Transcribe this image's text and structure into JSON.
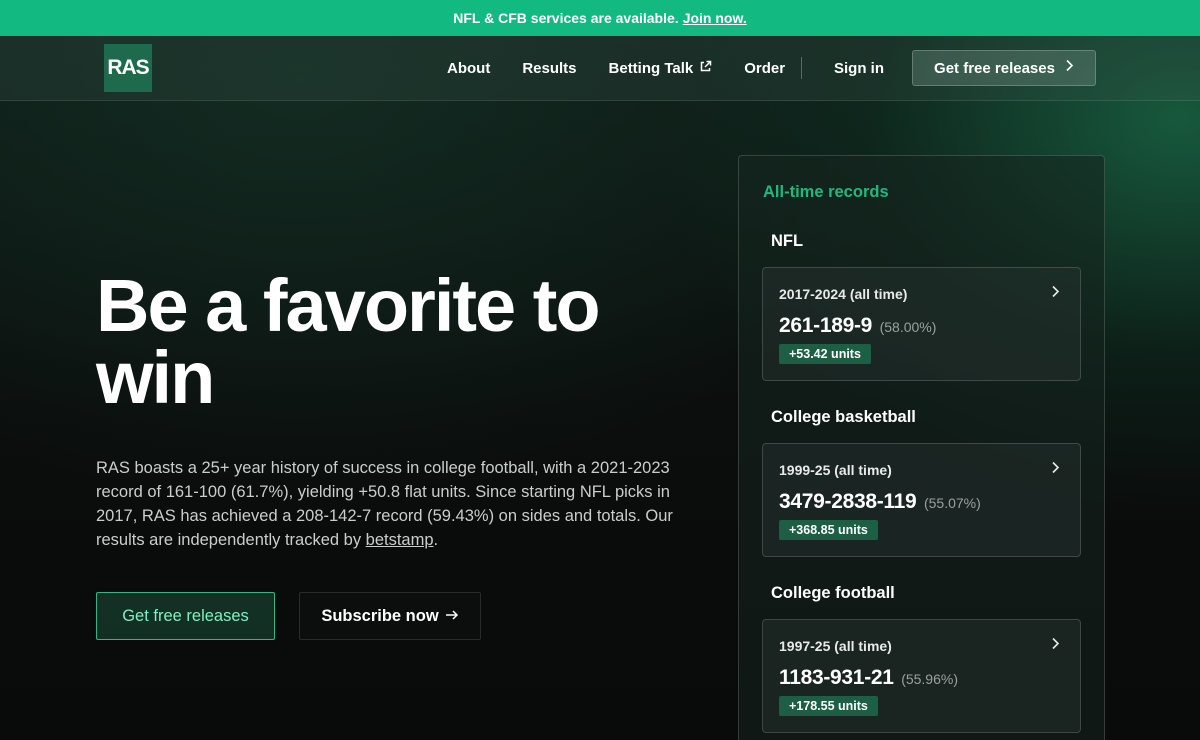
{
  "announcement": {
    "text": "NFL & CFB services are available.",
    "link": "Join now."
  },
  "nav": {
    "logo": "RAS",
    "links": [
      "About",
      "Results",
      "Betting Talk",
      "Order"
    ],
    "signin": "Sign in",
    "cta": "Get free releases"
  },
  "hero": {
    "title": "Be a favorite to win",
    "description": "RAS boasts a 25+ year history of success in college football, with a 2021-2023 record of 161-100 (61.7%), yielding +50.8 flat units. Since starting NFL picks in 2017, RAS has achieved a 208-142-7 record (59.43%) on sides and totals. Our results are independently tracked by ",
    "description_link": "betstamp",
    "description_end": ".",
    "primary_button": "Get free releases",
    "secondary_button": "Subscribe now"
  },
  "records": {
    "title": "All-time records",
    "sports": [
      {
        "name": "NFL",
        "period": "2017-2024 (all time)",
        "record": "261-189-9",
        "pct": "(58.00%)",
        "units": "+53.42 units"
      },
      {
        "name": "College basketball",
        "period": "1999-25 (all time)",
        "record": "3479-2838-119",
        "pct": "(55.07%)",
        "units": "+368.85 units"
      },
      {
        "name": "College football",
        "period": "1997-25 (all time)",
        "record": "1183-931-21",
        "pct": "(55.96%)",
        "units": "+178.55 units"
      }
    ]
  },
  "colors": {
    "accent": "#12b981",
    "badge": "#1d5f45",
    "records_title": "#1fb97e"
  },
  "icons": [
    "external-link-icon",
    "chevron-right-icon",
    "arrow-right-icon"
  ]
}
